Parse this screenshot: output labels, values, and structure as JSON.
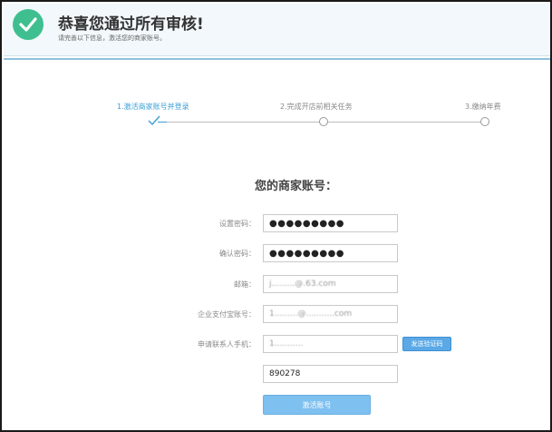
{
  "header": {
    "title": "恭喜您通过所有审核!",
    "subtitle": "请完善以下信息，激活您的商家账号。",
    "check_icon": "checkmark-circle-icon"
  },
  "steps": [
    {
      "label": "1.激活商家账号并登录",
      "state": "active"
    },
    {
      "label": "2.完成开店前相关任务",
      "state": "pending"
    },
    {
      "label": "3.缴纳年费",
      "state": "pending"
    }
  ],
  "form": {
    "title": "您的商家账号：",
    "set_password_label": "设置密码：",
    "set_password_value": "●●●●●●●●●",
    "confirm_password_label": "确认密码：",
    "confirm_password_value": "●●●●●●●●●",
    "email_label": "邮箱：",
    "email_value": "j.........@.63.com",
    "alipay_label": "企业支付宝账号：",
    "alipay_value": "1.........@...........com",
    "phone_label": "申请联系人手机：",
    "phone_value": "1...........",
    "send_code_label": "发送验证码",
    "code_value": "890278",
    "activate_label": "激活账号"
  },
  "colors": {
    "accent": "#3a9fd6",
    "success": "#3fbf8f",
    "button": "#7ec0ef"
  }
}
